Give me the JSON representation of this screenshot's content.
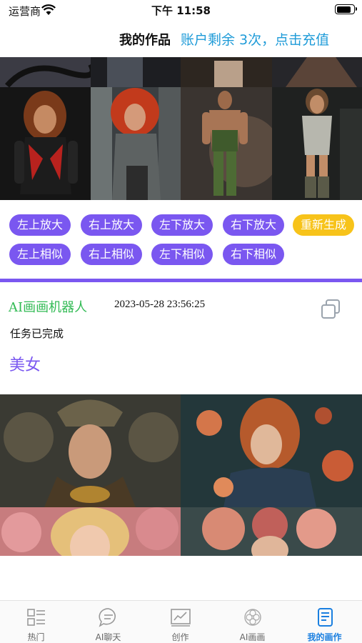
{
  "status_bar": {
    "carrier": "运营商",
    "time": "下午 11:58",
    "battery_level": 0.9
  },
  "header": {
    "title": "我的作品",
    "recharge_text": "账户剩余 3次，点击充值"
  },
  "top_images": {
    "alt": [
      "fighter-woman-red-black-suit",
      "red-haired-woman",
      "muscular-man-green",
      "armored-woman-boots"
    ]
  },
  "actions": {
    "row1": [
      "左上放大",
      "右上放大",
      "左下放大",
      "右下放大",
      "重新生成"
    ],
    "row2": [
      "左上相似",
      "右上相似",
      "左下相似",
      "右下相似"
    ]
  },
  "task": {
    "bot_name": "AI画画机器人",
    "timestamp": "2023-05-28 23:56:25",
    "status": "任务已完成",
    "prompt": "美女"
  },
  "bottom_images": {
    "alt": [
      "crowned-woman-ornate",
      "redhead-woman-flowers",
      "woman-pink-flowers",
      "woman-flower-crown"
    ]
  },
  "tabbar": {
    "items": [
      {
        "label": "热门",
        "icon": "list-icon"
      },
      {
        "label": "AI聊天",
        "icon": "chat-icon"
      },
      {
        "label": "创作",
        "icon": "chart-icon"
      },
      {
        "label": "AI画画",
        "icon": "flower-icon"
      },
      {
        "label": "我的画作",
        "icon": "document-icon",
        "active": true
      }
    ]
  },
  "colors": {
    "accent": "#7a57f0",
    "yellow": "#f7c31a",
    "link": "#1e9bd8",
    "bot": "#33bb55",
    "tab_active": "#1a7fe0"
  }
}
